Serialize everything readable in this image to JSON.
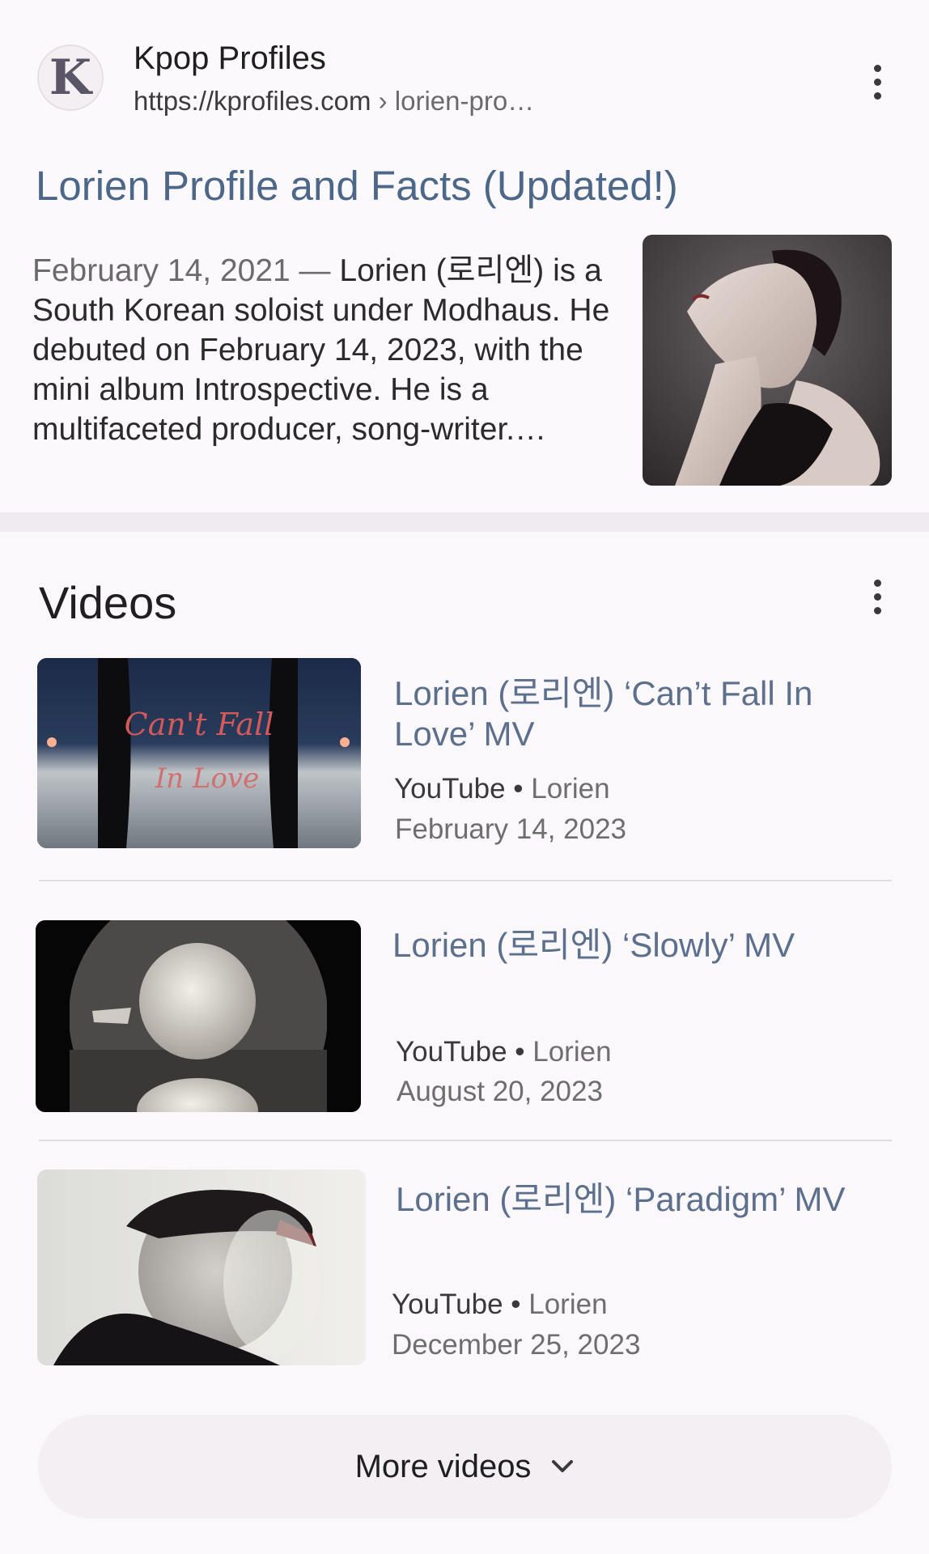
{
  "result": {
    "logo_letter": "K",
    "site_name": "Kpop Profiles",
    "url": "https://kprofiles.com",
    "url_crumb": " › lorien-pro…",
    "title": "Lorien Profile and Facts (Updated!)",
    "snippet_date": "February 14, 2021 — ",
    "snippet_text": "Lorien (로리엔) is a South Korean soloist under Modhaus. He debuted on February 14, 2023, with the mini album Introspective. He is a multifaceted producer, song-writer.…",
    "menu_icon": "more-vert-icon"
  },
  "videos": {
    "heading": "Videos",
    "menu_icon": "more-vert-icon",
    "items": [
      {
        "title": "Lorien (로리엔) ‘Can’t Fall In Love’ MV",
        "source": "YouTube",
        "separator": " • ",
        "channel": "Lorien",
        "date": "February 14, 2023",
        "thumb_text_1": "Can't Fall",
        "thumb_text_2": "In Love"
      },
      {
        "title": "Lorien (로리엔) ‘Slowly’ MV",
        "source": "YouTube",
        "separator": " • ",
        "channel": "Lorien",
        "date": "August 20, 2023"
      },
      {
        "title": "Lorien (로리엔) ‘Paradigm’ MV",
        "source": "YouTube",
        "separator": " • ",
        "channel": "Lorien",
        "date": "December 25, 2023"
      }
    ],
    "more_label": "More videos",
    "more_icon": "chevron-down-icon"
  },
  "colors": {
    "title_link": "#4d6788",
    "video_link": "#5c6f8c",
    "background": "#fbf8fb"
  }
}
